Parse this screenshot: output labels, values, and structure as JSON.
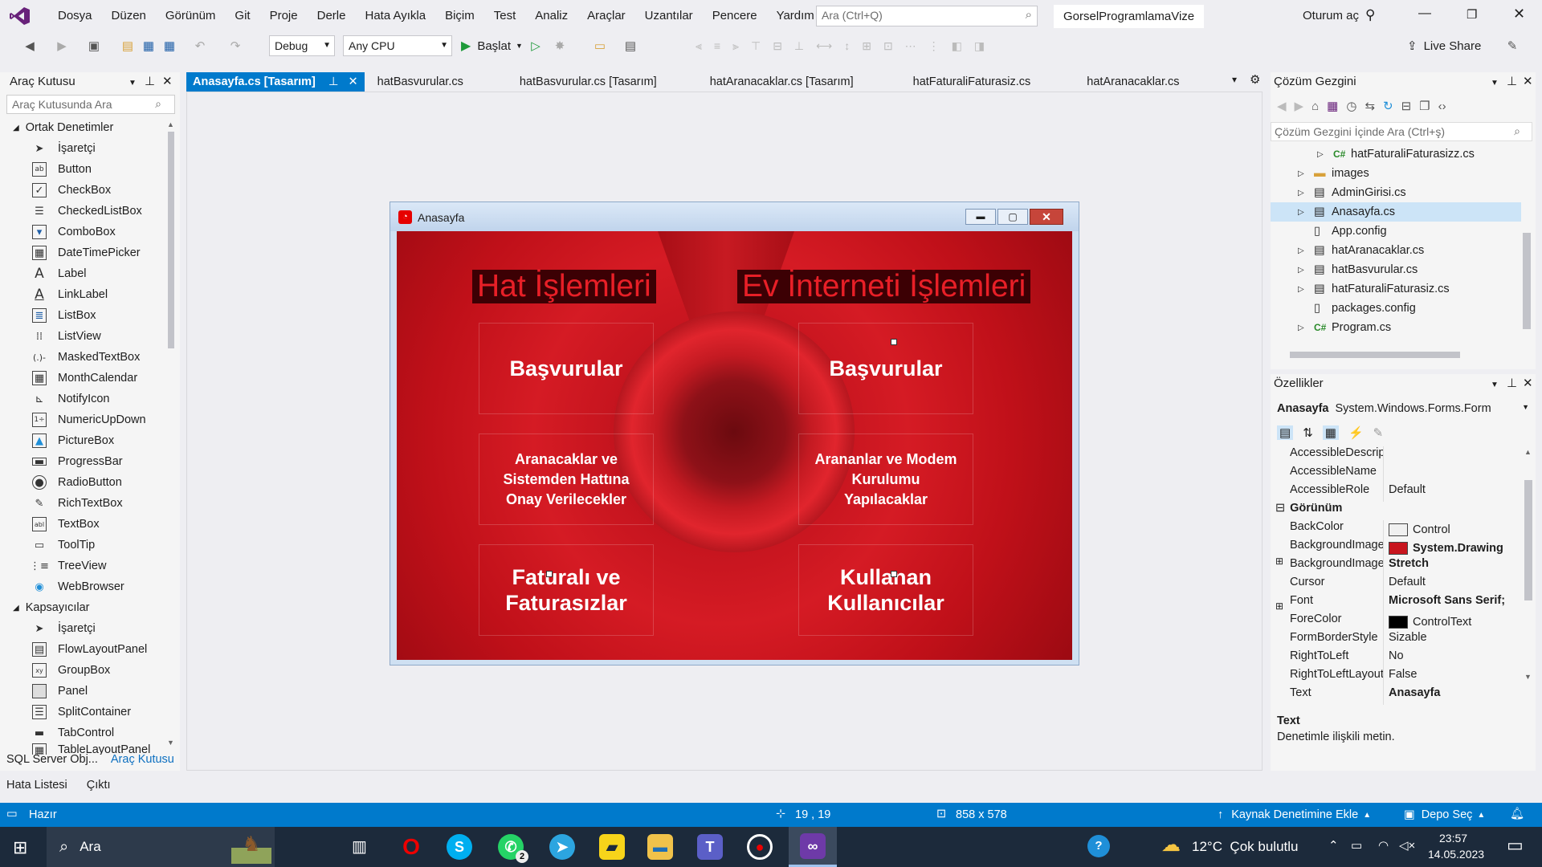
{
  "menu": {
    "items": [
      "Dosya",
      "Düzen",
      "Görünüm",
      "Git",
      "Proje",
      "Derle",
      "Hata Ayıkla",
      "Biçim",
      "Test",
      "Analiz",
      "Araçlar",
      "Uzantılar",
      "Pencere",
      "Yardım"
    ],
    "search_placeholder": "Ara (Ctrl+Q)",
    "project_title": "GorselProgramlamaVize",
    "signin": "Oturum aç",
    "live_share": "Live Share"
  },
  "toolbar": {
    "config": "Debug",
    "platform": "Any CPU",
    "start_label": "Başlat"
  },
  "toolbox": {
    "title": "Araç Kutusu",
    "search_placeholder": "Araç Kutusunda Ara",
    "group1": "Ortak Denetimler",
    "group1_items": [
      "İşaretçi",
      "Button",
      "CheckBox",
      "CheckedListBox",
      "ComboBox",
      "DateTimePicker",
      "Label",
      "LinkLabel",
      "ListBox",
      "ListView",
      "MaskedTextBox",
      "MonthCalendar",
      "NotifyIcon",
      "NumericUpDown",
      "PictureBox",
      "ProgressBar",
      "RadioButton",
      "RichTextBox",
      "TextBox",
      "ToolTip",
      "TreeView",
      "WebBrowser"
    ],
    "group2": "Kapsayıcılar",
    "group2_items": [
      "İşaretçi",
      "FlowLayoutPanel",
      "GroupBox",
      "Panel",
      "SplitContainer",
      "TabControl",
      "TableLayoutPanel"
    ],
    "bottom_tabs": [
      "SQL Server Obj...",
      "Araç Kutusu"
    ],
    "extra_tabs": [
      "Hata Listesi",
      "Çıktı"
    ]
  },
  "doc_tabs": [
    "Anasayfa.cs [Tasarım]",
    "hatBasvurular.cs",
    "hatBasvurular.cs [Tasarım]",
    "hatAranacaklar.cs [Tasarım]",
    "hatFaturaliFaturasiz.cs",
    "hatAranacaklar.cs"
  ],
  "form": {
    "title": "Anasayfa",
    "heading_left": "Hat İşlemleri",
    "heading_right": "Ev İnterneti İşlemleri",
    "buttons": {
      "b1": "Başvurular",
      "b2": "Başvurular",
      "b3": "Aranacaklar ve Sistemden Hattına Onay Verilecekler",
      "b4": "Arananlar ve Modem Kurulumu Yapılacaklar",
      "b5": "Faturalı ve Faturasızlar",
      "b6": "Kullanan Kullanıcılar"
    }
  },
  "solution_explorer": {
    "title": "Çözüm Gezgini",
    "search_placeholder": "Çözüm Gezgini İçinde Ara (Ctrl+ş)",
    "items": [
      "hatFaturaliFaturasizz.cs",
      "images",
      "AdminGirisi.cs",
      "Anasayfa.cs",
      "App.config",
      "hatAranacaklar.cs",
      "hatBasvurular.cs",
      "hatFaturaliFaturasiz.cs",
      "packages.config",
      "Program.cs"
    ]
  },
  "properties": {
    "title": "Özellikler",
    "object_name": "Anasayfa",
    "object_type": "System.Windows.Forms.Form",
    "category": "Görünüm",
    "rows": [
      {
        "name": "AccessibleDescriptic",
        "value": ""
      },
      {
        "name": "AccessibleName",
        "value": ""
      },
      {
        "name": "AccessibleRole",
        "value": "Default"
      },
      {
        "name": "BackColor",
        "value": "Control"
      },
      {
        "name": "BackgroundImage",
        "value": "System.Drawing"
      },
      {
        "name": "BackgroundImageLa",
        "value": "Stretch"
      },
      {
        "name": "Cursor",
        "value": "Default"
      },
      {
        "name": "Font",
        "value": "Microsoft Sans Serif;"
      },
      {
        "name": "ForeColor",
        "value": "ControlText"
      },
      {
        "name": "FormBorderStyle",
        "value": "Sizable"
      },
      {
        "name": "RightToLeft",
        "value": "No"
      },
      {
        "name": "RightToLeftLayout",
        "value": "False"
      },
      {
        "name": "Text",
        "value": "Anasayfa"
      }
    ],
    "desc_title": "Text",
    "desc_text": "Denetimle ilişkili metin."
  },
  "status": {
    "ready": "Hazır",
    "position": "19 , 19",
    "size": "858 x 578",
    "source_control": "Kaynak Denetimine Ekle",
    "repo": "Depo Seç"
  },
  "taskbar": {
    "search_label": "Ara",
    "weather": "12°C  Çok bulutlu",
    "time": "23:57",
    "date": "14.05.2023",
    "whatsapp_badge": "2"
  },
  "colors": {
    "accent": "#007acc",
    "brand": "#68217a",
    "form_red": "#d51b24"
  }
}
